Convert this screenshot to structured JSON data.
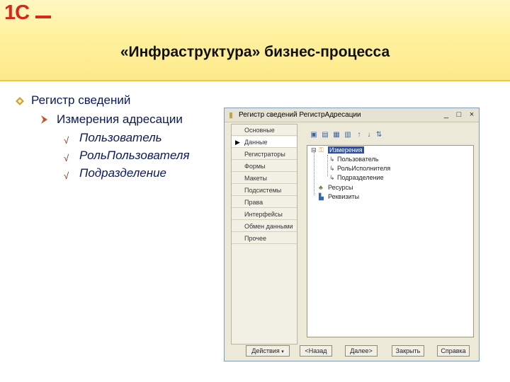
{
  "logo": {
    "text": "1С"
  },
  "slide": {
    "title": "«Инфраструктура» бизнес-процесса"
  },
  "bullets": {
    "level1": "Регистр сведений",
    "level2": "Измерения адресации",
    "level3": [
      "Пользователь",
      "РольПользователя",
      "Подразделение"
    ]
  },
  "window": {
    "title": "Регистр сведений РегистрАдресации",
    "controls": [
      "_",
      "□",
      "×"
    ],
    "tabs": [
      "Основные",
      "Данные",
      "Регистраторы",
      "Формы",
      "Макеты",
      "Подсистемы",
      "Права",
      "Интерфейсы",
      "Обмен данными",
      "Прочее"
    ],
    "tree": {
      "dimensions": "Измерения",
      "items": [
        "Пользователь",
        "РольИсполнителя",
        "Подразделение"
      ],
      "resources": "Ресурсы",
      "attributes": "Реквизиты"
    },
    "buttons": [
      "Действия",
      "<Назад",
      "Далее>",
      "Закрыть",
      "Справка"
    ]
  },
  "colors": {
    "banner_top": "#fff7c4",
    "banner_bottom": "#fde98a",
    "logo_red": "#d7261e",
    "text_blue": "#0b1a5a",
    "selection": "#2b4fa8"
  }
}
